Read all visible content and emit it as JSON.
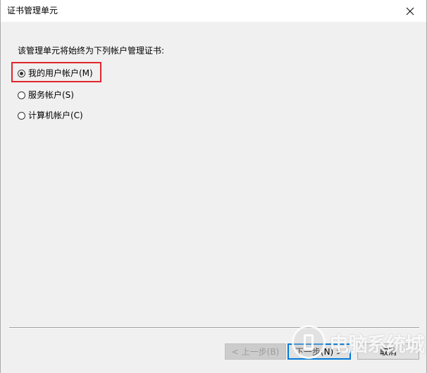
{
  "window": {
    "title": "证书管理单元"
  },
  "prompt": "该管理单元将始终为下列帐户管理证书:",
  "options": [
    {
      "label": "我的用户帐户(M)",
      "checked": true
    },
    {
      "label": "服务帐户(S)",
      "checked": false
    },
    {
      "label": "计算机帐户(C)",
      "checked": false
    }
  ],
  "buttons": {
    "back": "< 上一步(B)",
    "next": "下一步(N) >",
    "cancel": "取消"
  },
  "watermark": {
    "text": "电脑系统城"
  },
  "colors": {
    "highlight": "#e0262b",
    "default_button_border": "#0078d7",
    "dialog_background": "#f0f0f0"
  },
  "icons": {
    "close": "close-icon"
  }
}
